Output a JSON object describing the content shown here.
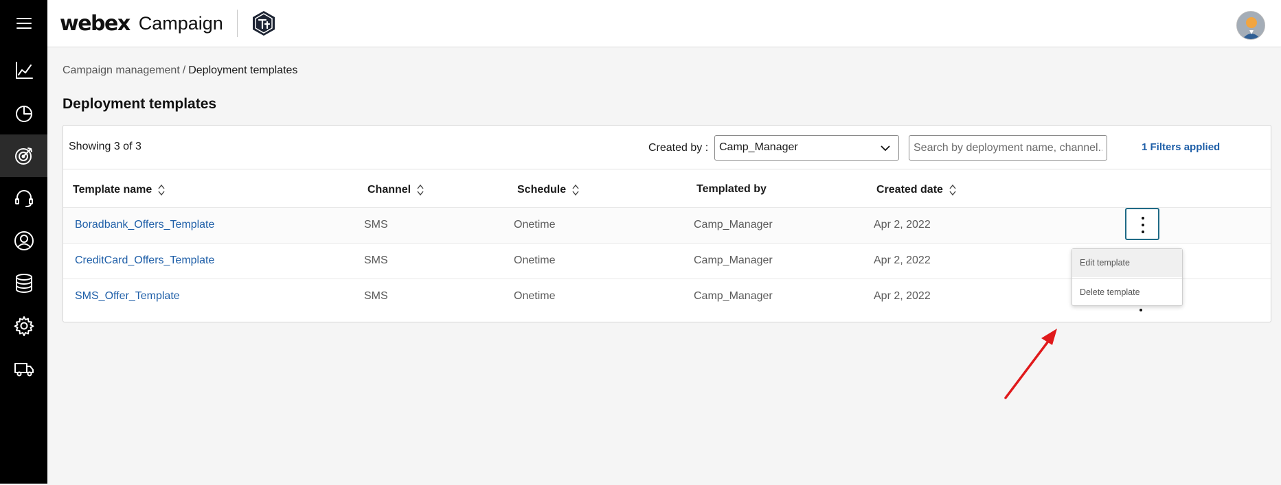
{
  "app": {
    "brand": "webex",
    "product": "Campaign"
  },
  "nav": {
    "items": [
      {
        "name": "menu",
        "icon": "hamburger-icon"
      },
      {
        "name": "analytics",
        "icon": "line-chart-icon"
      },
      {
        "name": "reports",
        "icon": "pie-chart-icon"
      },
      {
        "name": "campaigns",
        "icon": "target-icon",
        "active": true
      },
      {
        "name": "support",
        "icon": "headset-icon"
      },
      {
        "name": "profile",
        "icon": "user-circle-icon"
      },
      {
        "name": "data",
        "icon": "database-icon"
      },
      {
        "name": "settings",
        "icon": "gear-icon"
      },
      {
        "name": "delivery",
        "icon": "truck-icon"
      }
    ]
  },
  "breadcrumb": {
    "parent": "Campaign management",
    "separator": "/",
    "current": "Deployment templates"
  },
  "page": {
    "title": "Deployment templates"
  },
  "toolbar": {
    "showing": "Showing 3 of 3",
    "created_by_label": "Created by :",
    "created_by_value": "Camp_Manager",
    "search_placeholder": "Search by deployment name, channel...",
    "filters_applied": "1 Filters applied"
  },
  "table": {
    "headers": {
      "template_name": "Template name",
      "channel": "Channel",
      "schedule": "Schedule",
      "templated_by": "Templated by",
      "created_date": "Created date"
    },
    "rows": [
      {
        "template_name": "Boradbank_Offers_Template",
        "channel": "SMS",
        "schedule": "Onetime",
        "templated_by": "Camp_Manager",
        "created_date": "Apr 2, 2022"
      },
      {
        "template_name": "CreditCard_Offers_Template",
        "channel": "SMS",
        "schedule": "Onetime",
        "templated_by": "Camp_Manager",
        "created_date": "Apr 2, 2022"
      },
      {
        "template_name": "SMS_Offer_Template",
        "channel": "SMS",
        "schedule": "Onetime",
        "templated_by": "Camp_Manager",
        "created_date": "Apr 2, 2022"
      }
    ]
  },
  "row_menu": {
    "items": [
      "Edit template",
      "Delete template"
    ]
  },
  "colors": {
    "rail": "#000000",
    "link": "#1f5fa8",
    "annotation_arrow": "#e0191b",
    "kebab_focus": "#1f6a86"
  }
}
